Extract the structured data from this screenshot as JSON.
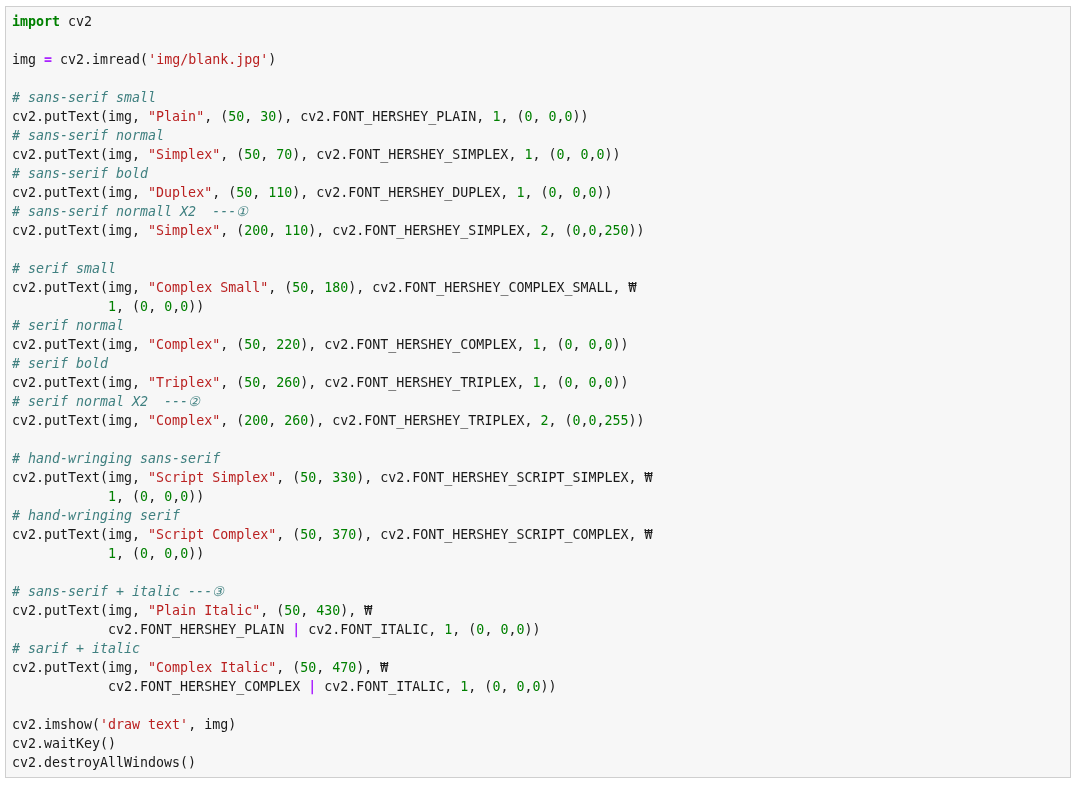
{
  "code_cell": {
    "lines": [
      {
        "kind": "code",
        "tokens": [
          {
            "kind": "keyword",
            "text": "import"
          },
          {
            "kind": "plain",
            "text": " cv2"
          }
        ]
      },
      {
        "kind": "blank"
      },
      {
        "kind": "code",
        "tokens": [
          {
            "kind": "plain",
            "text": "img "
          },
          {
            "kind": "operator",
            "text": "="
          },
          {
            "kind": "plain",
            "text": " cv2.imread("
          },
          {
            "kind": "string",
            "text": "'img/blank.jpg'"
          },
          {
            "kind": "plain",
            "text": ")"
          }
        ]
      },
      {
        "kind": "blank"
      },
      {
        "kind": "code",
        "tokens": [
          {
            "kind": "comment",
            "text": "# sans-serif small"
          }
        ]
      },
      {
        "kind": "code",
        "tokens": [
          {
            "kind": "plain",
            "text": "cv2.putText(img, "
          },
          {
            "kind": "string",
            "text": "\"Plain\""
          },
          {
            "kind": "plain",
            "text": ", ("
          },
          {
            "kind": "number",
            "text": "50"
          },
          {
            "kind": "plain",
            "text": ", "
          },
          {
            "kind": "number",
            "text": "30"
          },
          {
            "kind": "plain",
            "text": "), cv2.FONT_HERSHEY_PLAIN, "
          },
          {
            "kind": "number",
            "text": "1"
          },
          {
            "kind": "plain",
            "text": ", ("
          },
          {
            "kind": "number",
            "text": "0"
          },
          {
            "kind": "plain",
            "text": ", "
          },
          {
            "kind": "number",
            "text": "0"
          },
          {
            "kind": "plain",
            "text": ","
          },
          {
            "kind": "number",
            "text": "0"
          },
          {
            "kind": "plain",
            "text": "))"
          }
        ]
      },
      {
        "kind": "code",
        "tokens": [
          {
            "kind": "comment",
            "text": "# sans-serif normal"
          }
        ]
      },
      {
        "kind": "code",
        "tokens": [
          {
            "kind": "plain",
            "text": "cv2.putText(img, "
          },
          {
            "kind": "string",
            "text": "\"Simplex\""
          },
          {
            "kind": "plain",
            "text": ", ("
          },
          {
            "kind": "number",
            "text": "50"
          },
          {
            "kind": "plain",
            "text": ", "
          },
          {
            "kind": "number",
            "text": "70"
          },
          {
            "kind": "plain",
            "text": "), cv2.FONT_HERSHEY_SIMPLEX, "
          },
          {
            "kind": "number",
            "text": "1"
          },
          {
            "kind": "plain",
            "text": ", ("
          },
          {
            "kind": "number",
            "text": "0"
          },
          {
            "kind": "plain",
            "text": ", "
          },
          {
            "kind": "number",
            "text": "0"
          },
          {
            "kind": "plain",
            "text": ","
          },
          {
            "kind": "number",
            "text": "0"
          },
          {
            "kind": "plain",
            "text": "))"
          }
        ]
      },
      {
        "kind": "code",
        "tokens": [
          {
            "kind": "comment",
            "text": "# sans-serif bold"
          }
        ]
      },
      {
        "kind": "code",
        "tokens": [
          {
            "kind": "plain",
            "text": "cv2.putText(img, "
          },
          {
            "kind": "string",
            "text": "\"Duplex\""
          },
          {
            "kind": "plain",
            "text": ", ("
          },
          {
            "kind": "number",
            "text": "50"
          },
          {
            "kind": "plain",
            "text": ", "
          },
          {
            "kind": "number",
            "text": "110"
          },
          {
            "kind": "plain",
            "text": "), cv2.FONT_HERSHEY_DUPLEX, "
          },
          {
            "kind": "number",
            "text": "1"
          },
          {
            "kind": "plain",
            "text": ", ("
          },
          {
            "kind": "number",
            "text": "0"
          },
          {
            "kind": "plain",
            "text": ", "
          },
          {
            "kind": "number",
            "text": "0"
          },
          {
            "kind": "plain",
            "text": ","
          },
          {
            "kind": "number",
            "text": "0"
          },
          {
            "kind": "plain",
            "text": "))"
          }
        ]
      },
      {
        "kind": "code",
        "tokens": [
          {
            "kind": "comment",
            "text": "# sans-serif normall X2  ---①"
          }
        ]
      },
      {
        "kind": "code",
        "tokens": [
          {
            "kind": "plain",
            "text": "cv2.putText(img, "
          },
          {
            "kind": "string",
            "text": "\"Simplex\""
          },
          {
            "kind": "plain",
            "text": ", ("
          },
          {
            "kind": "number",
            "text": "200"
          },
          {
            "kind": "plain",
            "text": ", "
          },
          {
            "kind": "number",
            "text": "110"
          },
          {
            "kind": "plain",
            "text": "), cv2.FONT_HERSHEY_SIMPLEX, "
          },
          {
            "kind": "number",
            "text": "2"
          },
          {
            "kind": "plain",
            "text": ", ("
          },
          {
            "kind": "number",
            "text": "0"
          },
          {
            "kind": "plain",
            "text": ","
          },
          {
            "kind": "number",
            "text": "0"
          },
          {
            "kind": "plain",
            "text": ","
          },
          {
            "kind": "number",
            "text": "250"
          },
          {
            "kind": "plain",
            "text": "))"
          }
        ]
      },
      {
        "kind": "blank"
      },
      {
        "kind": "code",
        "tokens": [
          {
            "kind": "comment",
            "text": "# serif small"
          }
        ]
      },
      {
        "kind": "code",
        "tokens": [
          {
            "kind": "plain",
            "text": "cv2.putText(img, "
          },
          {
            "kind": "string",
            "text": "\"Complex Small\""
          },
          {
            "kind": "plain",
            "text": ", ("
          },
          {
            "kind": "number",
            "text": "50"
          },
          {
            "kind": "plain",
            "text": ", "
          },
          {
            "kind": "number",
            "text": "180"
          },
          {
            "kind": "plain",
            "text": "), cv2.FONT_HERSHEY_COMPLEX_SMALL, ₩"
          }
        ]
      },
      {
        "kind": "continuation",
        "tokens": [
          {
            "kind": "number",
            "text": "1"
          },
          {
            "kind": "plain",
            "text": ", ("
          },
          {
            "kind": "number",
            "text": "0"
          },
          {
            "kind": "plain",
            "text": ", "
          },
          {
            "kind": "number",
            "text": "0"
          },
          {
            "kind": "plain",
            "text": ","
          },
          {
            "kind": "number",
            "text": "0"
          },
          {
            "kind": "plain",
            "text": "))"
          }
        ]
      },
      {
        "kind": "code",
        "tokens": [
          {
            "kind": "comment",
            "text": "# serif normal"
          }
        ]
      },
      {
        "kind": "code",
        "tokens": [
          {
            "kind": "plain",
            "text": "cv2.putText(img, "
          },
          {
            "kind": "string",
            "text": "\"Complex\""
          },
          {
            "kind": "plain",
            "text": ", ("
          },
          {
            "kind": "number",
            "text": "50"
          },
          {
            "kind": "plain",
            "text": ", "
          },
          {
            "kind": "number",
            "text": "220"
          },
          {
            "kind": "plain",
            "text": "), cv2.FONT_HERSHEY_COMPLEX, "
          },
          {
            "kind": "number",
            "text": "1"
          },
          {
            "kind": "plain",
            "text": ", ("
          },
          {
            "kind": "number",
            "text": "0"
          },
          {
            "kind": "plain",
            "text": ", "
          },
          {
            "kind": "number",
            "text": "0"
          },
          {
            "kind": "plain",
            "text": ","
          },
          {
            "kind": "number",
            "text": "0"
          },
          {
            "kind": "plain",
            "text": "))"
          }
        ]
      },
      {
        "kind": "code",
        "tokens": [
          {
            "kind": "comment",
            "text": "# serif bold"
          }
        ]
      },
      {
        "kind": "code",
        "tokens": [
          {
            "kind": "plain",
            "text": "cv2.putText(img, "
          },
          {
            "kind": "string",
            "text": "\"Triplex\""
          },
          {
            "kind": "plain",
            "text": ", ("
          },
          {
            "kind": "number",
            "text": "50"
          },
          {
            "kind": "plain",
            "text": ", "
          },
          {
            "kind": "number",
            "text": "260"
          },
          {
            "kind": "plain",
            "text": "), cv2.FONT_HERSHEY_TRIPLEX, "
          },
          {
            "kind": "number",
            "text": "1"
          },
          {
            "kind": "plain",
            "text": ", ("
          },
          {
            "kind": "number",
            "text": "0"
          },
          {
            "kind": "plain",
            "text": ", "
          },
          {
            "kind": "number",
            "text": "0"
          },
          {
            "kind": "plain",
            "text": ","
          },
          {
            "kind": "number",
            "text": "0"
          },
          {
            "kind": "plain",
            "text": "))"
          }
        ]
      },
      {
        "kind": "code",
        "tokens": [
          {
            "kind": "comment",
            "text": "# serif normal X2  ---②"
          }
        ]
      },
      {
        "kind": "code",
        "tokens": [
          {
            "kind": "plain",
            "text": "cv2.putText(img, "
          },
          {
            "kind": "string",
            "text": "\"Complex\""
          },
          {
            "kind": "plain",
            "text": ", ("
          },
          {
            "kind": "number",
            "text": "200"
          },
          {
            "kind": "plain",
            "text": ", "
          },
          {
            "kind": "number",
            "text": "260"
          },
          {
            "kind": "plain",
            "text": "), cv2.FONT_HERSHEY_TRIPLEX, "
          },
          {
            "kind": "number",
            "text": "2"
          },
          {
            "kind": "plain",
            "text": ", ("
          },
          {
            "kind": "number",
            "text": "0"
          },
          {
            "kind": "plain",
            "text": ","
          },
          {
            "kind": "number",
            "text": "0"
          },
          {
            "kind": "plain",
            "text": ","
          },
          {
            "kind": "number",
            "text": "255"
          },
          {
            "kind": "plain",
            "text": "))"
          }
        ]
      },
      {
        "kind": "blank"
      },
      {
        "kind": "code",
        "tokens": [
          {
            "kind": "comment",
            "text": "# hand-wringing sans-serif"
          }
        ]
      },
      {
        "kind": "code",
        "tokens": [
          {
            "kind": "plain",
            "text": "cv2.putText(img, "
          },
          {
            "kind": "string",
            "text": "\"Script Simplex\""
          },
          {
            "kind": "plain",
            "text": ", ("
          },
          {
            "kind": "number",
            "text": "50"
          },
          {
            "kind": "plain",
            "text": ", "
          },
          {
            "kind": "number",
            "text": "330"
          },
          {
            "kind": "plain",
            "text": "), cv2.FONT_HERSHEY_SCRIPT_SIMPLEX, ₩"
          }
        ]
      },
      {
        "kind": "continuation",
        "tokens": [
          {
            "kind": "number",
            "text": "1"
          },
          {
            "kind": "plain",
            "text": ", ("
          },
          {
            "kind": "number",
            "text": "0"
          },
          {
            "kind": "plain",
            "text": ", "
          },
          {
            "kind": "number",
            "text": "0"
          },
          {
            "kind": "plain",
            "text": ","
          },
          {
            "kind": "number",
            "text": "0"
          },
          {
            "kind": "plain",
            "text": "))"
          }
        ]
      },
      {
        "kind": "code",
        "tokens": [
          {
            "kind": "comment",
            "text": "# hand-wringing serif"
          }
        ]
      },
      {
        "kind": "code",
        "tokens": [
          {
            "kind": "plain",
            "text": "cv2.putText(img, "
          },
          {
            "kind": "string",
            "text": "\"Script Complex\""
          },
          {
            "kind": "plain",
            "text": ", ("
          },
          {
            "kind": "number",
            "text": "50"
          },
          {
            "kind": "plain",
            "text": ", "
          },
          {
            "kind": "number",
            "text": "370"
          },
          {
            "kind": "plain",
            "text": "), cv2.FONT_HERSHEY_SCRIPT_COMPLEX, ₩"
          }
        ]
      },
      {
        "kind": "continuation",
        "tokens": [
          {
            "kind": "number",
            "text": "1"
          },
          {
            "kind": "plain",
            "text": ", ("
          },
          {
            "kind": "number",
            "text": "0"
          },
          {
            "kind": "plain",
            "text": ", "
          },
          {
            "kind": "number",
            "text": "0"
          },
          {
            "kind": "plain",
            "text": ","
          },
          {
            "kind": "number",
            "text": "0"
          },
          {
            "kind": "plain",
            "text": "))"
          }
        ]
      },
      {
        "kind": "blank"
      },
      {
        "kind": "code",
        "tokens": [
          {
            "kind": "comment",
            "text": "# sans-serif + italic ---③"
          }
        ]
      },
      {
        "kind": "code",
        "tokens": [
          {
            "kind": "plain",
            "text": "cv2.putText(img, "
          },
          {
            "kind": "string",
            "text": "\"Plain Italic\""
          },
          {
            "kind": "plain",
            "text": ", ("
          },
          {
            "kind": "number",
            "text": "50"
          },
          {
            "kind": "plain",
            "text": ", "
          },
          {
            "kind": "number",
            "text": "430"
          },
          {
            "kind": "plain",
            "text": "), ₩"
          }
        ]
      },
      {
        "kind": "continuation",
        "tokens": [
          {
            "kind": "plain",
            "text": "cv2.FONT_HERSHEY_PLAIN "
          },
          {
            "kind": "operator",
            "text": "|"
          },
          {
            "kind": "plain",
            "text": " cv2.FONT_ITALIC, "
          },
          {
            "kind": "number",
            "text": "1"
          },
          {
            "kind": "plain",
            "text": ", ("
          },
          {
            "kind": "number",
            "text": "0"
          },
          {
            "kind": "plain",
            "text": ", "
          },
          {
            "kind": "number",
            "text": "0"
          },
          {
            "kind": "plain",
            "text": ","
          },
          {
            "kind": "number",
            "text": "0"
          },
          {
            "kind": "plain",
            "text": "))"
          }
        ]
      },
      {
        "kind": "code",
        "tokens": [
          {
            "kind": "comment",
            "text": "# sarif + italic"
          }
        ]
      },
      {
        "kind": "code",
        "tokens": [
          {
            "kind": "plain",
            "text": "cv2.putText(img, "
          },
          {
            "kind": "string",
            "text": "\"Complex Italic\""
          },
          {
            "kind": "plain",
            "text": ", ("
          },
          {
            "kind": "number",
            "text": "50"
          },
          {
            "kind": "plain",
            "text": ", "
          },
          {
            "kind": "number",
            "text": "470"
          },
          {
            "kind": "plain",
            "text": "), ₩"
          }
        ]
      },
      {
        "kind": "continuation",
        "tokens": [
          {
            "kind": "plain",
            "text": "cv2.FONT_HERSHEY_COMPLEX "
          },
          {
            "kind": "operator",
            "text": "|"
          },
          {
            "kind": "plain",
            "text": " cv2.FONT_ITALIC, "
          },
          {
            "kind": "number",
            "text": "1"
          },
          {
            "kind": "plain",
            "text": ", ("
          },
          {
            "kind": "number",
            "text": "0"
          },
          {
            "kind": "plain",
            "text": ", "
          },
          {
            "kind": "number",
            "text": "0"
          },
          {
            "kind": "plain",
            "text": ","
          },
          {
            "kind": "number",
            "text": "0"
          },
          {
            "kind": "plain",
            "text": "))"
          }
        ]
      },
      {
        "kind": "blank"
      },
      {
        "kind": "code",
        "tokens": [
          {
            "kind": "plain",
            "text": "cv2.imshow("
          },
          {
            "kind": "string",
            "text": "'draw text'"
          },
          {
            "kind": "plain",
            "text": ", img)"
          }
        ]
      },
      {
        "kind": "code",
        "tokens": [
          {
            "kind": "plain",
            "text": "cv2.waitKey()"
          }
        ]
      },
      {
        "kind": "code",
        "tokens": [
          {
            "kind": "plain",
            "text": "cv2.destroyAllWindows()"
          }
        ]
      }
    ]
  }
}
